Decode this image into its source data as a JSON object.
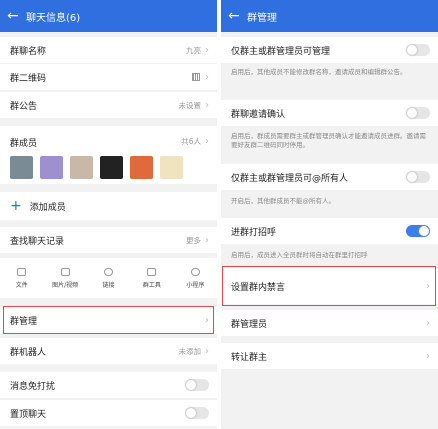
{
  "left": {
    "header_title": "聊天信息(6)",
    "group_name": {
      "label": "群聊名称",
      "value": "九亮"
    },
    "group_qr": {
      "label": "群二维码"
    },
    "announcement": {
      "label": "群公告",
      "value": "未设置"
    },
    "members": {
      "label": "群成员",
      "value": "共6人"
    },
    "avatar_colors": [
      "#7a8b95",
      "#9d8fd0",
      "#c9b8a8",
      "#222",
      "#e06a3c",
      "#efe3c0"
    ],
    "add_member": "添加成员",
    "find_history": {
      "label": "查找聊天记录",
      "value": "更多"
    },
    "tools": [
      "文件",
      "图片/视频",
      "链接",
      "群工具",
      "小程序"
    ],
    "group_manage": "群管理",
    "group_robot": {
      "label": "群机器人",
      "value": "未添加"
    },
    "mute": "消息免打扰",
    "pin": "置顶聊天"
  },
  "right": {
    "header_title": "群管理",
    "only_admin_manage": "仅群主或群管理员可管理",
    "only_admin_desc": "启用后，其他成员不能修改群名称，邀请成员和编辑群公告。",
    "invite_confirm": "群聊邀请确认",
    "invite_desc": "启用后，群成员需要群主或群管理员确认才能邀请成员进群。邀请需要好友群二维码同时停用。",
    "at_all": "仅群主或群管理员可@所有人",
    "at_all_desc": "开启后，其他群成员不能@所有人。",
    "welcome": "进群打招呼",
    "welcome_desc": "启用后，成员进入全员群时将自动在群里打招呼",
    "ban": "设置群内禁言",
    "admins": "群管理员",
    "transfer": "转让群主"
  }
}
